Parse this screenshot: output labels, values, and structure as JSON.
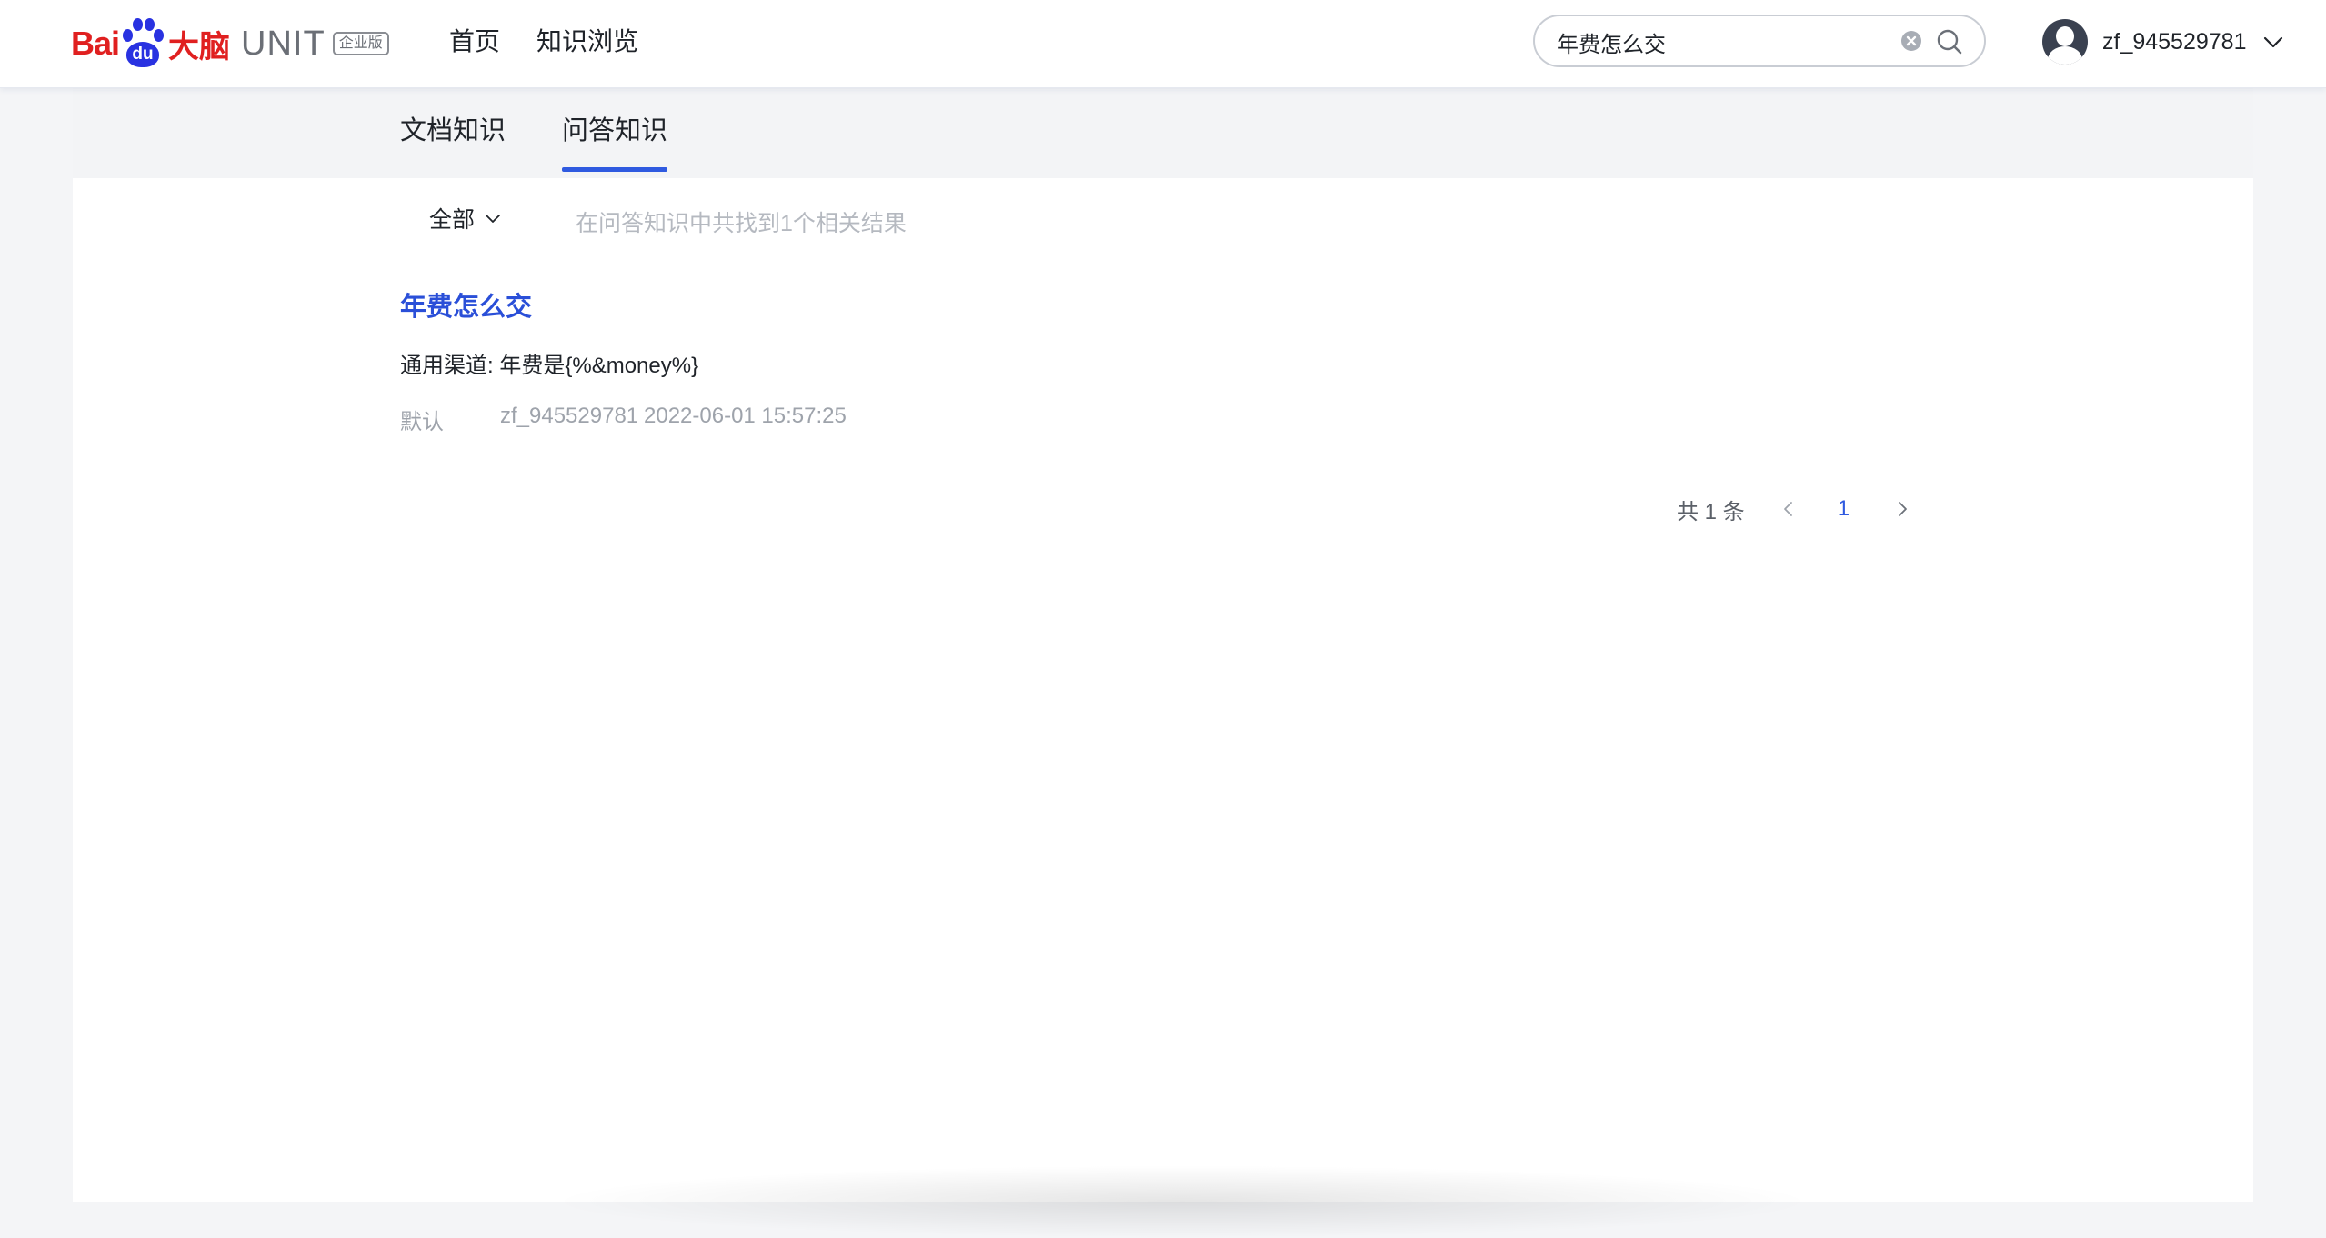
{
  "brand": {
    "bai": "Bai",
    "du": "du",
    "danao": "大脑",
    "unit": "UNIT",
    "badge": "企业版"
  },
  "nav": {
    "items": [
      {
        "label": "首页"
      },
      {
        "label": "知识浏览"
      }
    ]
  },
  "search": {
    "value": "年费怎么交"
  },
  "user": {
    "name": "zf_945529781"
  },
  "tabs": [
    {
      "label": "文档知识",
      "active": false
    },
    {
      "label": "问答知识",
      "active": true
    }
  ],
  "filter": {
    "selected": "全部",
    "summary": "在问答知识中共找到1个相关结果"
  },
  "results": [
    {
      "title": "年费怎么交",
      "answer": "通用渠道: 年费是{%&money%}",
      "category": "默认",
      "author": "zf_945529781",
      "timestamp": "2022-06-01 15:57:25"
    }
  ],
  "pagination": {
    "total_label": "共 1 条",
    "current_page": "1"
  },
  "colors": {
    "accent": "#2f5ae0",
    "title_link": "#2a4fd8",
    "brand_red": "#e02020",
    "brand_blue": "#2932e1"
  },
  "icons": {
    "clear": "clear-icon",
    "search": "search-icon",
    "dropdown": "chevron-down-icon",
    "prev": "chevron-left-icon",
    "next": "chevron-right-icon"
  }
}
